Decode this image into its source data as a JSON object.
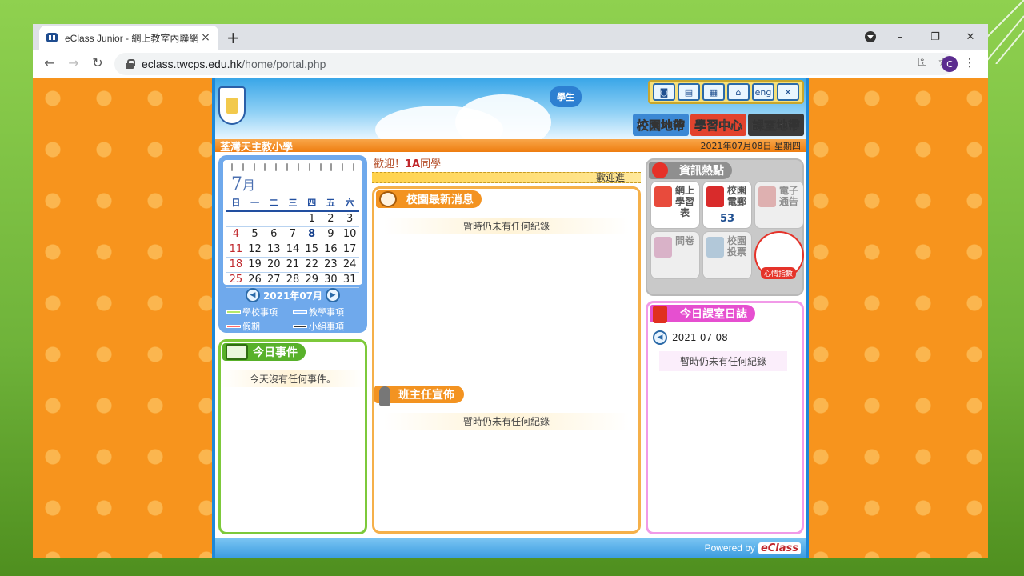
{
  "browser": {
    "tab_title": "eClass Junior - 網上教室內聯網",
    "tab_close": "×",
    "new_tab": "+",
    "url_host": "eclass.twcps.edu.hk",
    "url_path": "/home/portal.php",
    "profile_initial": "C",
    "win_min": "–",
    "win_restore": "❐",
    "win_close": "✕",
    "back": "←",
    "forward": "→",
    "reload": "↻",
    "key_icon": "⚿",
    "star_icon": "☆",
    "menu_icon": "⋮"
  },
  "header": {
    "student_label": "學生",
    "top_icons": [
      "◙",
      "▤",
      "▦",
      "⌂",
      "eng",
      "✕"
    ],
    "zones": [
      "校園地帶",
      "學習中心",
      "課室地帶"
    ],
    "school_name": "荃灣天主教小學",
    "date": "2021年07月08日 星期四"
  },
  "calendar": {
    "month_num": "7",
    "month_char": "月",
    "weekdays": [
      "日",
      "一",
      "二",
      "三",
      "四",
      "五",
      "六"
    ],
    "rows": [
      [
        "",
        "",
        "",
        "",
        "1",
        "2",
        "3"
      ],
      [
        "4",
        "5",
        "6",
        "7",
        "8",
        "9",
        "10"
      ],
      [
        "11",
        "12",
        "13",
        "14",
        "15",
        "16",
        "17"
      ],
      [
        "18",
        "19",
        "20",
        "21",
        "22",
        "23",
        "24"
      ],
      [
        "25",
        "26",
        "27",
        "28",
        "29",
        "30",
        "31"
      ]
    ],
    "today": "8",
    "nav_label": "2021年07月",
    "legend": [
      "學校事項",
      "教學事項",
      "假期",
      "小組事項"
    ],
    "legend_colors": [
      "#b5e86a",
      "#8fc0ff",
      "#ff6b6b",
      "#333333"
    ]
  },
  "events": {
    "title": "今日事件",
    "empty": "今天沒有任何事件。"
  },
  "welcome": {
    "prefix": "歡迎！",
    "class": "1A",
    "suffix": "同學",
    "bar_text": "歡迎進"
  },
  "news": {
    "title": "校園最新消息",
    "empty": "暫時仍未有任何紀錄"
  },
  "teacher": {
    "title": "班主任宣佈",
    "empty": "暫時仍未有任何紀錄"
  },
  "info": {
    "title": "資訊熱點",
    "tiles": [
      {
        "label": "網上學習表",
        "count": ""
      },
      {
        "label": "校園電郵",
        "count": "53"
      },
      {
        "label": "電子通告",
        "count": ""
      },
      {
        "label": "問卷",
        "count": ""
      },
      {
        "label": "校園投票",
        "count": ""
      }
    ],
    "mood_label": "心情指數"
  },
  "diary": {
    "title": "今日課室日誌",
    "date": "2021-07-08",
    "empty": "暫時仍未有任何紀錄"
  },
  "footer": {
    "powered": "Powered by",
    "brand": "eClass"
  }
}
